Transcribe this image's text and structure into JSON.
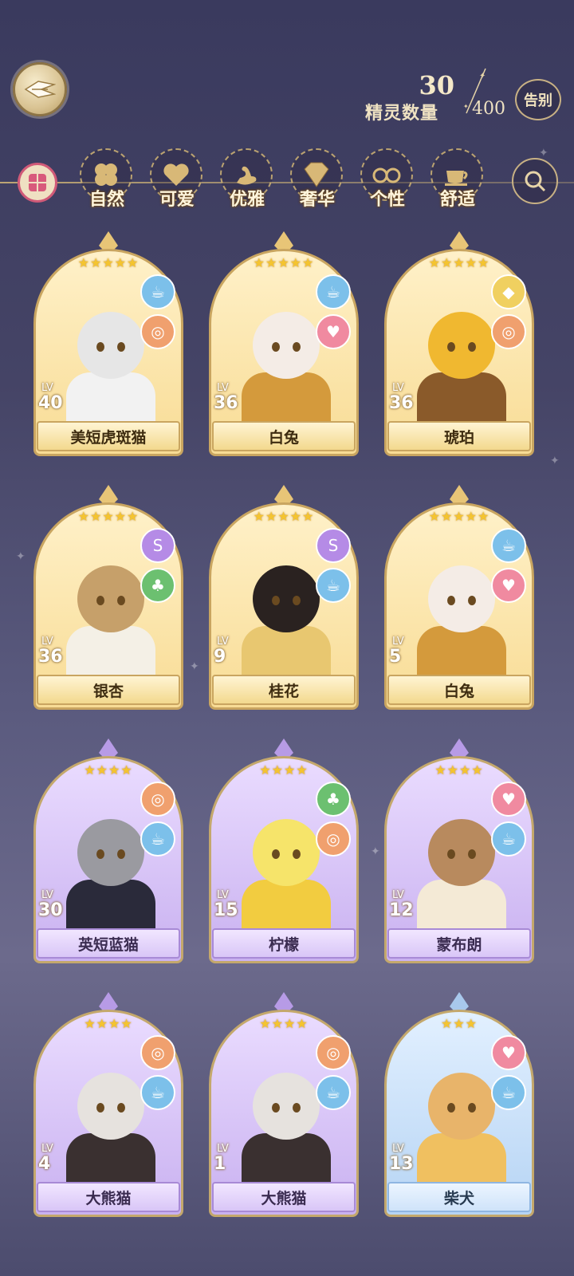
{
  "header": {
    "count_current": "30",
    "count_label": "精灵数量",
    "count_max": "400",
    "farewell_label": "告别"
  },
  "filters": [
    {
      "label": "自然",
      "icon": "clover-icon",
      "color": "#6cb86a"
    },
    {
      "label": "可爱",
      "icon": "heart-icon",
      "color": "#e47a8e"
    },
    {
      "label": "优雅",
      "icon": "swan-icon",
      "color": "#a17ad8"
    },
    {
      "label": "奢华",
      "icon": "gem-icon",
      "color": "#e3c24b"
    },
    {
      "label": "个性",
      "icon": "glasses-icon",
      "color": "#e48050"
    },
    {
      "label": "舒适",
      "icon": "teacup-icon",
      "color": "#6aaee0"
    }
  ],
  "cards": [
    {
      "name": "美短虎斑猫",
      "lv_label": "LV",
      "level": "40",
      "stars": "★★★★★",
      "rarity": "gold",
      "tags": [
        "teacup-icon",
        "glasses-icon"
      ]
    },
    {
      "name": "白兔",
      "lv_label": "LV",
      "level": "36",
      "stars": "★★★★★",
      "rarity": "gold",
      "tags": [
        "teacup-icon",
        "heart-icon"
      ]
    },
    {
      "name": "琥珀",
      "lv_label": "LV",
      "level": "36",
      "stars": "★★★★★",
      "rarity": "gold",
      "tags": [
        "gem-icon",
        "glasses-icon"
      ]
    },
    {
      "name": "银杏",
      "lv_label": "LV",
      "level": "36",
      "stars": "★★★★★",
      "rarity": "gold",
      "tags": [
        "swan-icon",
        "clover-icon"
      ]
    },
    {
      "name": "桂花",
      "lv_label": "LV",
      "level": "9",
      "stars": "★★★★★",
      "rarity": "gold",
      "tags": [
        "swan-icon",
        "teacup-icon"
      ]
    },
    {
      "name": "白兔",
      "lv_label": "LV",
      "level": "5",
      "stars": "★★★★★",
      "rarity": "gold",
      "tags": [
        "teacup-icon",
        "heart-icon"
      ]
    },
    {
      "name": "英短蓝猫",
      "lv_label": "LV",
      "level": "30",
      "stars": "★★★★",
      "rarity": "purple",
      "tags": [
        "glasses-icon",
        "teacup-icon"
      ]
    },
    {
      "name": "柠檬",
      "lv_label": "LV",
      "level": "15",
      "stars": "★★★★",
      "rarity": "purple",
      "tags": [
        "clover-icon",
        "glasses-icon"
      ]
    },
    {
      "name": "蒙布朗",
      "lv_label": "LV",
      "level": "12",
      "stars": "★★★★",
      "rarity": "purple",
      "tags": [
        "heart-icon",
        "teacup-icon"
      ]
    },
    {
      "name": "大熊猫",
      "lv_label": "LV",
      "level": "4",
      "stars": "★★★★",
      "rarity": "purple",
      "tags": [
        "glasses-icon",
        "teacup-icon"
      ]
    },
    {
      "name": "大熊猫",
      "lv_label": "LV",
      "level": "1",
      "stars": "★★★★",
      "rarity": "purple",
      "tags": [
        "glasses-icon",
        "teacup-icon"
      ]
    },
    {
      "name": "柴犬",
      "lv_label": "LV",
      "level": "13",
      "stars": "★★★",
      "rarity": "blue",
      "tags": [
        "heart-icon",
        "teacup-icon"
      ]
    }
  ]
}
